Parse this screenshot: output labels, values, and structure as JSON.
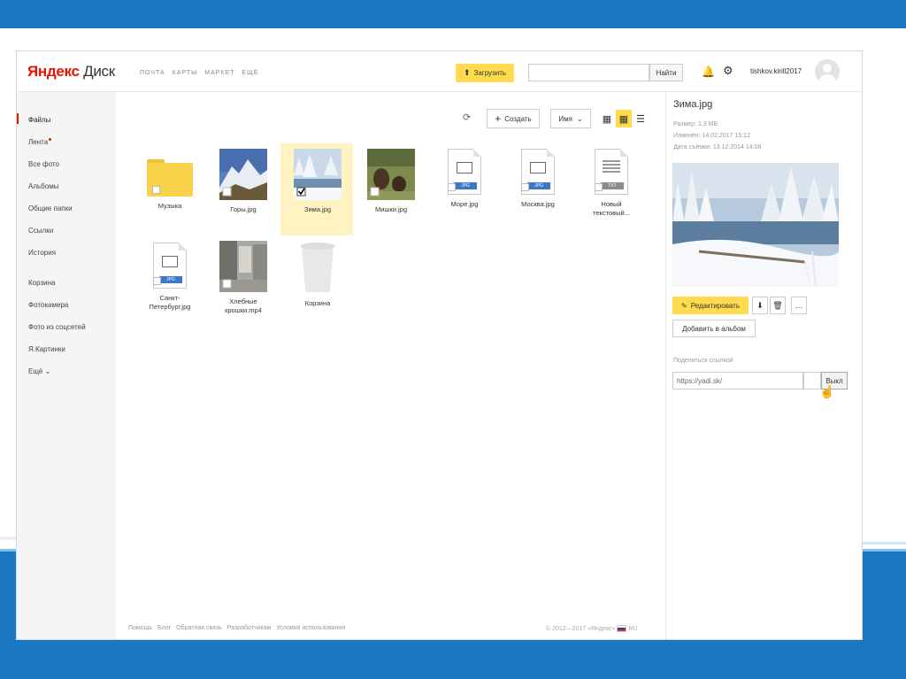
{
  "header": {
    "logo_brand": "Яндекс",
    "logo_product": "Диск",
    "services": [
      "ПОЧТА",
      "КАРТЫ",
      "МАРКЕТ",
      "ЕЩЁ"
    ],
    "upload_label": "Загрузить",
    "search_placeholder": "",
    "search_button": "Найти",
    "username": "tishkov.kirill2017"
  },
  "sidebar": {
    "items": [
      "Файлы",
      "Лента",
      "Все фото",
      "Альбомы",
      "Общие папки",
      "Ссылки",
      "История",
      "Корзина",
      "Фотокамера",
      "Фото из соцсетей",
      "Я.Картинки",
      "Ещё ⌄"
    ],
    "active_item": "Файлы"
  },
  "toolbar": {
    "create_label": "Создать",
    "sort_label": "Имя"
  },
  "files": [
    {
      "name": "Музыка",
      "kind": "folder"
    },
    {
      "name": "Горы.jpg",
      "kind": "photo"
    },
    {
      "name": "Зима.jpg",
      "kind": "photo",
      "selected": true
    },
    {
      "name": "Мишки.jpg",
      "kind": "photo"
    },
    {
      "name": "Море.jpg",
      "kind": "doc",
      "ext": "JPG"
    },
    {
      "name": "Москва.jpg",
      "kind": "doc",
      "ext": "JPG"
    },
    {
      "name": "Новый текстовый...",
      "kind": "doc",
      "ext": "TXT"
    },
    {
      "name": "Санкт-Петербург.jpg",
      "kind": "doc",
      "ext": "JPG"
    },
    {
      "name": "Хлебные крошки.mp4",
      "kind": "photo"
    },
    {
      "name": "Корзина",
      "kind": "trash"
    }
  ],
  "panel": {
    "title": "Зима.jpg",
    "size": "Размер: 1,3 МБ",
    "modified": "Изменён: 14.02.2017 15:12",
    "taken": "Дата съёмки: 13.12.2014 14:08",
    "edit_label": "Редактировать",
    "add_album_label": "Добавить в альбом",
    "share_label": "Поделиться ссылкой",
    "share_url": "https://yadi.sk/",
    "share_off_label": "Выкл"
  },
  "footer": {
    "links": [
      "Помощь",
      "Блог",
      "Обратная связь",
      "Разработчикам",
      "Условия использования"
    ],
    "copyright": "© 2012—2017 «Яндекс» ",
    "lang": "RU"
  },
  "colors": {
    "accent_yellow": "#ffdb4d",
    "brand_red": "#e61400",
    "slide_blue": "#1a78c2"
  }
}
